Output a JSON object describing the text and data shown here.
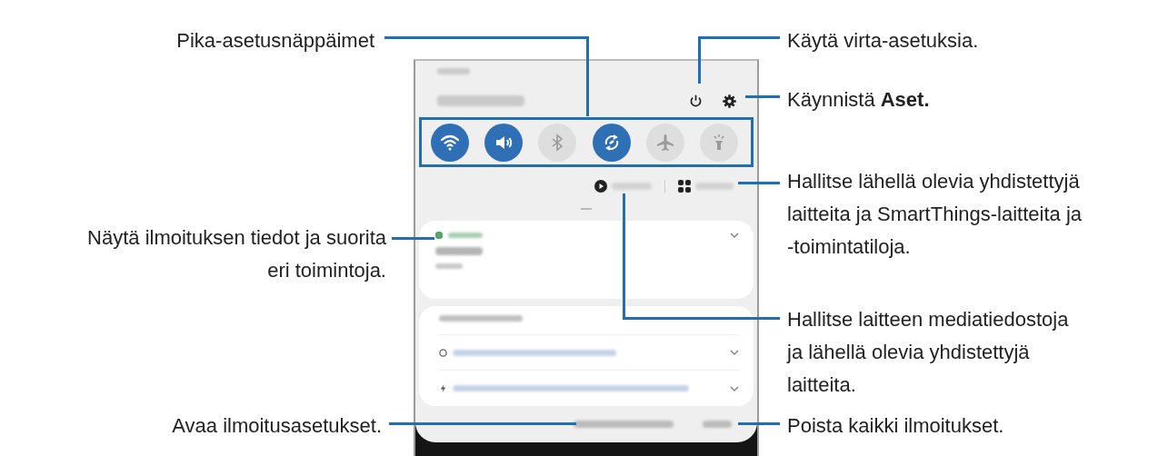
{
  "callouts": [
    {
      "text": "Pika-asetusnäppäimet"
    },
    {
      "text": "Käytä virta-asetuksia."
    },
    {
      "text": "Käynnistä **Aset.**"
    },
    {
      "text": "Hallitse lähellä olevia yhdistettyjä\nlaitteita ja SmartThings-laitteita ja\n-toimintatiloja."
    },
    {
      "text": "Näytä ilmoituksen tiedot ja suorita\neri toimintoja."
    },
    {
      "text": "Hallitse laitteen mediatiedostoja\nja lähellä olevia yhdistettyjä\nlaitteita."
    },
    {
      "text": "Avaa ilmoitusasetukset."
    },
    {
      "text": "Poista kaikki ilmoitukset."
    }
  ],
  "quick_settings": [
    {
      "kind": "wifi",
      "on": true
    },
    {
      "kind": "sound",
      "on": true
    },
    {
      "kind": "bluetooth",
      "on": false
    },
    {
      "kind": "sync",
      "on": true
    },
    {
      "kind": "airplane",
      "on": false
    },
    {
      "kind": "flashlight",
      "on": false
    }
  ]
}
